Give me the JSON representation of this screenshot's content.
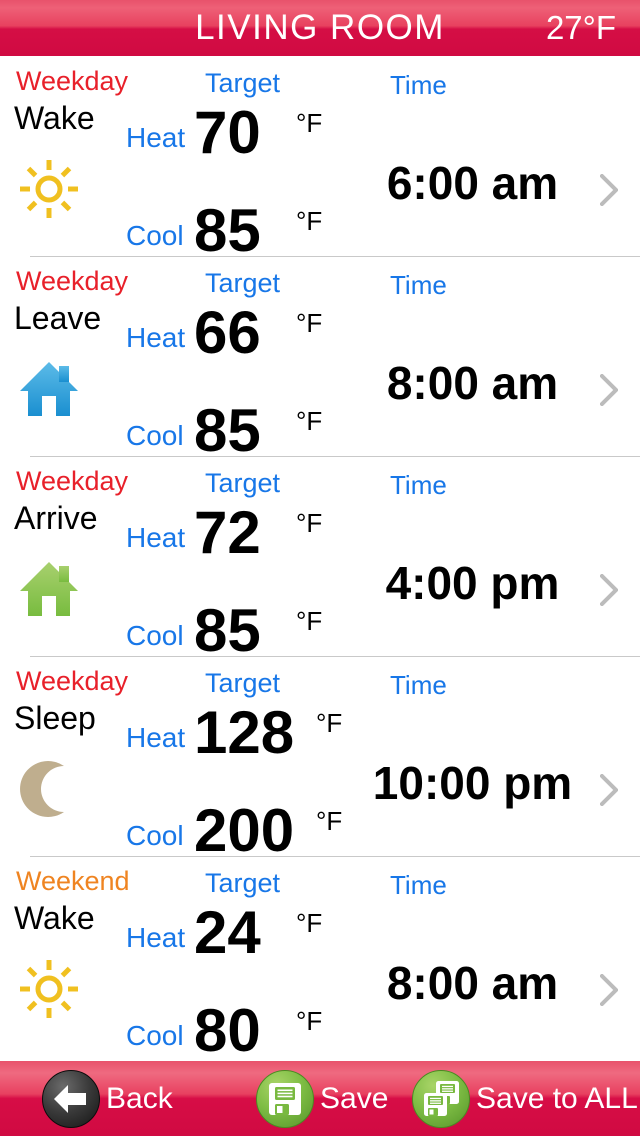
{
  "header": {
    "title": "LIVING ROOM",
    "temperature": "27°F",
    "background_color": "#d50e45"
  },
  "columns": {
    "target_label": "Target",
    "time_label": "Time"
  },
  "labels": {
    "heat": "Heat",
    "cool": "Cool",
    "unit": "°F"
  },
  "colors": {
    "weekday": "#e8202a",
    "weekend": "#ef8421",
    "accent_blue": "#1877e8",
    "sun": "#f0c020",
    "house_leave": "#2e9fd9",
    "house_arrive": "#8cc152",
    "moon": "#bfae8e"
  },
  "schedule": [
    {
      "day_type": "Weekday",
      "day_type_class": "weekday",
      "period": "Wake",
      "icon": "sun-icon",
      "target_label": "Target",
      "time_label": "Time",
      "heat_label": "Heat",
      "heat_value": "70",
      "heat_unit": "°F",
      "cool_label": "Cool",
      "cool_value": "85",
      "cool_unit": "°F",
      "time": "6:00 am"
    },
    {
      "day_type": "Weekday",
      "day_type_class": "weekday",
      "period": "Leave",
      "icon": "house-blue-icon",
      "target_label": "Target",
      "time_label": "Time",
      "heat_label": "Heat",
      "heat_value": "66",
      "heat_unit": "°F",
      "cool_label": "Cool",
      "cool_value": "85",
      "cool_unit": "°F",
      "time": "8:00 am"
    },
    {
      "day_type": "Weekday",
      "day_type_class": "weekday",
      "period": "Arrive",
      "icon": "house-green-icon",
      "target_label": "Target",
      "time_label": "Time",
      "heat_label": "Heat",
      "heat_value": "72",
      "heat_unit": "°F",
      "cool_label": "Cool",
      "cool_value": "85",
      "cool_unit": "°F",
      "time": "4:00 pm"
    },
    {
      "day_type": "Weekday",
      "day_type_class": "weekday",
      "period": "Sleep",
      "icon": "moon-icon",
      "target_label": "Target",
      "time_label": "Time",
      "heat_label": "Heat",
      "heat_value": "128",
      "heat_unit": "°F",
      "cool_label": "Cool",
      "cool_value": "200",
      "cool_unit": "°F",
      "time": "10:00 pm"
    },
    {
      "day_type": "Weekend",
      "day_type_class": "weekend",
      "period": "Wake",
      "icon": "sun-icon",
      "target_label": "Target",
      "time_label": "Time",
      "heat_label": "Heat",
      "heat_value": "24",
      "heat_unit": "°F",
      "cool_label": "Cool",
      "cool_value": "80",
      "cool_unit": "°F",
      "time": "8:00 am"
    }
  ],
  "toolbar": {
    "back_label": "Back",
    "save_label": "Save",
    "save_all_label": "Save to ALL"
  }
}
